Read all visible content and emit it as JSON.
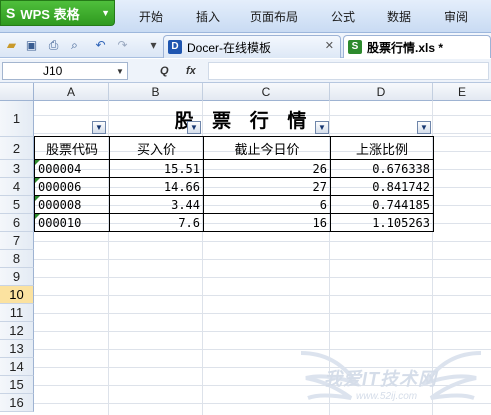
{
  "ribbon": {
    "app_button": "WPS 表格",
    "app_logo": "S",
    "tabs": [
      "开始",
      "插入",
      "页面布局",
      "公式",
      "数据",
      "审阅"
    ]
  },
  "quickbar": {
    "icons": [
      "open-folder-icon",
      "save-icon",
      "print-icon",
      "print-preview-icon",
      "undo-icon",
      "redo-icon",
      "customize-icon"
    ]
  },
  "doc_tabs": [
    {
      "label": "Docer-在线模板",
      "icon": "docer-icon",
      "active": false
    },
    {
      "label": "股票行情.xls *",
      "icon": "spreadsheet-icon",
      "active": true
    }
  ],
  "formula_bar": {
    "cell_ref": "J10",
    "formula": ""
  },
  "columns": [
    "A",
    "B",
    "C",
    "D",
    "E"
  ],
  "rows": [
    "1",
    "2",
    "3",
    "4",
    "5",
    "6",
    "7",
    "8",
    "9",
    "10",
    "11",
    "12",
    "13",
    "14",
    "15",
    "16"
  ],
  "selected_row": "10",
  "sheet": {
    "title": "股 票 行 情",
    "headers": [
      "股票代码",
      "买入价",
      "截止今日价",
      "上涨比例"
    ],
    "rows": [
      [
        "000004",
        "15.51",
        "26",
        "0.676338"
      ],
      [
        "000006",
        "14.66",
        "27",
        "0.841742"
      ],
      [
        "000008",
        "3.44",
        "6",
        "0.744185"
      ],
      [
        "000010",
        "7.6",
        "16",
        "1.105263"
      ]
    ]
  },
  "watermark": {
    "text": "我爱IT技术网",
    "url": "www.52ij.com"
  }
}
